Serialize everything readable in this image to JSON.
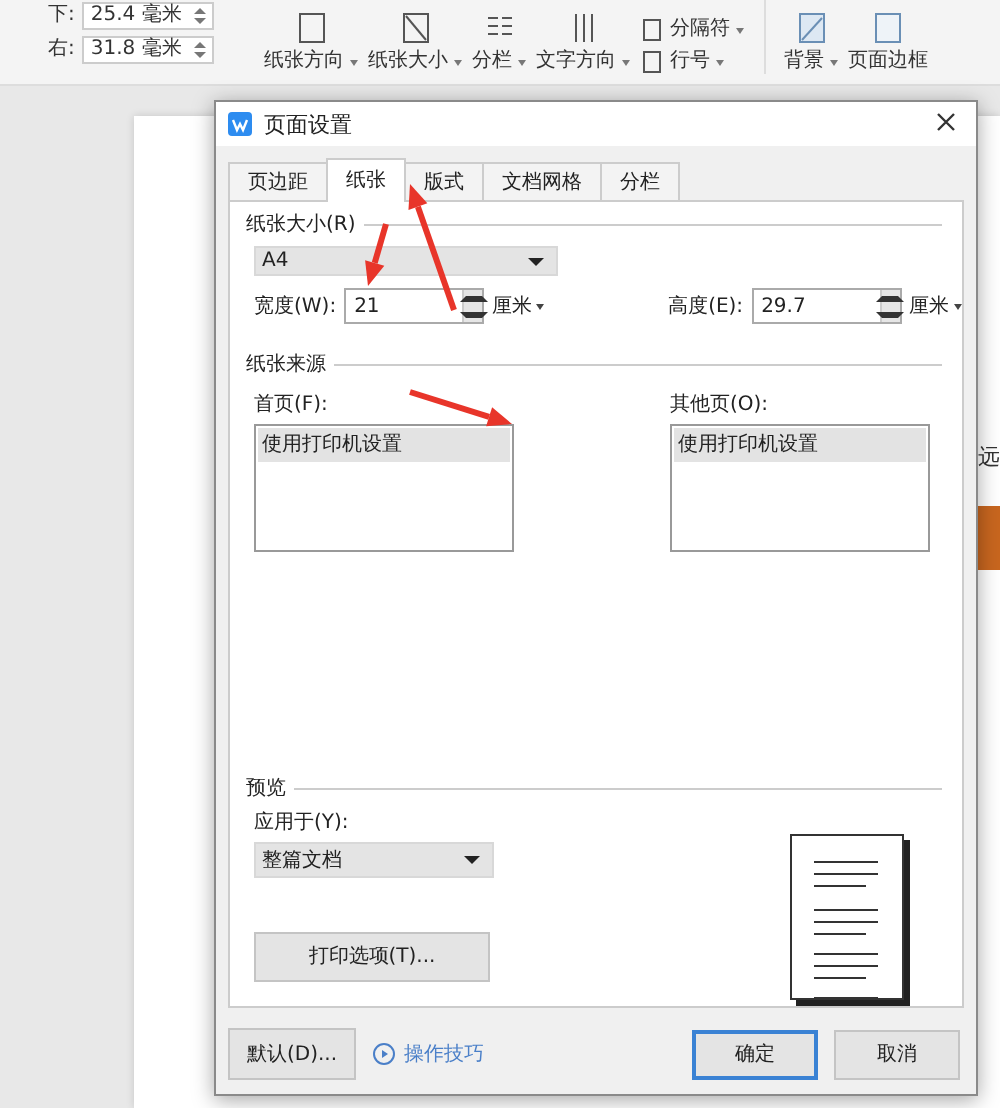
{
  "toolbar": {
    "margins": [
      {
        "label": "下:",
        "value": "25.4 毫米"
      },
      {
        "label": "右:",
        "value": "31.8 毫米"
      }
    ],
    "items": [
      {
        "label": "纸张方向",
        "has_menu": true,
        "kind": "orientation"
      },
      {
        "label": "纸张大小",
        "has_menu": true,
        "kind": "size"
      },
      {
        "label": "分栏",
        "has_menu": true,
        "kind": "columns"
      },
      {
        "label": "文字方向",
        "has_menu": true,
        "kind": "direction"
      },
      {
        "kind": "stack",
        "rows": [
          {
            "label": "分隔符",
            "has_menu": true
          },
          {
            "label": "行号",
            "has_menu": true
          }
        ]
      },
      {
        "label": "背景",
        "has_menu": true,
        "kind": "background"
      },
      {
        "label": "页面边框",
        "has_menu": false,
        "kind": "border"
      }
    ]
  },
  "document": {
    "text": "远"
  },
  "dialog": {
    "title": "页面设置",
    "tabs": [
      {
        "label": "页边距",
        "selected": false
      },
      {
        "label": "纸张",
        "selected": true
      },
      {
        "label": "版式",
        "selected": false
      },
      {
        "label": "文档网格",
        "selected": false
      },
      {
        "label": "分栏",
        "selected": false
      }
    ],
    "paper_size": {
      "label": "纸张大小(R)",
      "value": "A4",
      "width": {
        "label": "宽度(W):",
        "value": "21",
        "unit": "厘米"
      },
      "height": {
        "label": "高度(E):",
        "value": "29.7",
        "unit": "厘米"
      }
    },
    "paper_source": {
      "label": "纸张来源",
      "lists": [
        {
          "label": "首页(F):",
          "items": [
            {
              "text": "使用打印机设置",
              "selected": true
            }
          ]
        },
        {
          "label": "其他页(O):",
          "items": [
            {
              "text": "使用打印机设置",
              "selected": true
            }
          ]
        }
      ]
    },
    "preview": {
      "label": "预览",
      "apply_label": "应用于(Y):",
      "apply_value": "整篇文档",
      "print_options": "打印选项(T)..."
    },
    "footer": {
      "default_button": "默认(D)...",
      "tips_link": "操作技巧",
      "ok": "确定",
      "cancel": "取消"
    }
  }
}
